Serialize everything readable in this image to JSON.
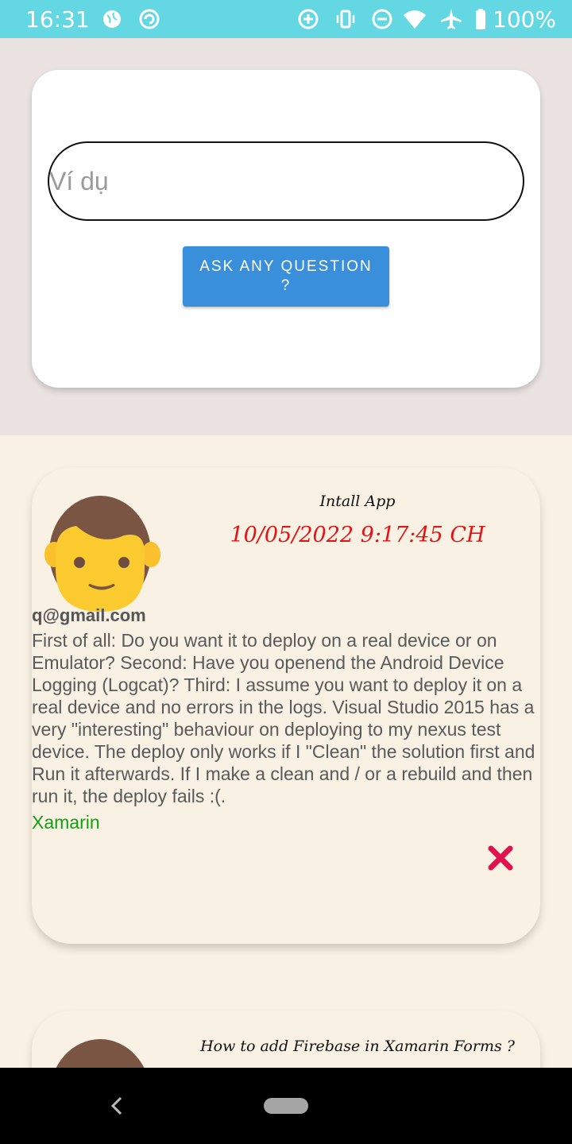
{
  "status_bar": {
    "time": "16:31",
    "battery_text": "100%",
    "icons": [
      "vpn-globe-icon",
      "sync-icon",
      "data-saver-icon",
      "vibrate-icon",
      "do-not-disturb-icon",
      "wifi-icon",
      "airplane-icon",
      "battery-icon"
    ]
  },
  "ask": {
    "placeholder": "Ví dụ",
    "button_label": "ASK ANY QUESTION ?"
  },
  "posts": [
    {
      "title": "Intall App",
      "date": "10/05/2022 9:17:45 CH",
      "email": "q@gmail.com",
      "body": "First of all: Do you want it to deploy on a real device or on Emulator? Second: Have you openend the Android Device Logging (Logcat)?  Third: I assume you want to deploy it on a real device and no errors in the logs.  Visual Studio 2015 has a very \"interesting\" behaviour on deploying to my nexus test device.  The deploy only works if I \"Clean\" the solution first and Run it afterwards. If I make a clean and / or a rebuild and then run it, the deploy fails :(.",
      "tag": "Xamarin",
      "avatar_icon": "person-avatar-icon",
      "delete_icon": "close-icon"
    },
    {
      "title": "How to add Firebase in Xamarin Forms ?",
      "avatar_icon": "person-avatar-icon"
    }
  ],
  "colors": {
    "status_bar": "#63d7e2",
    "button": "#3a8fdb",
    "date_text": "#e01515",
    "tag_text": "#12a012",
    "delete_icon": "#e0144c"
  },
  "nav_bar": {
    "icons": [
      "back-icon",
      "home-pill-icon"
    ]
  }
}
